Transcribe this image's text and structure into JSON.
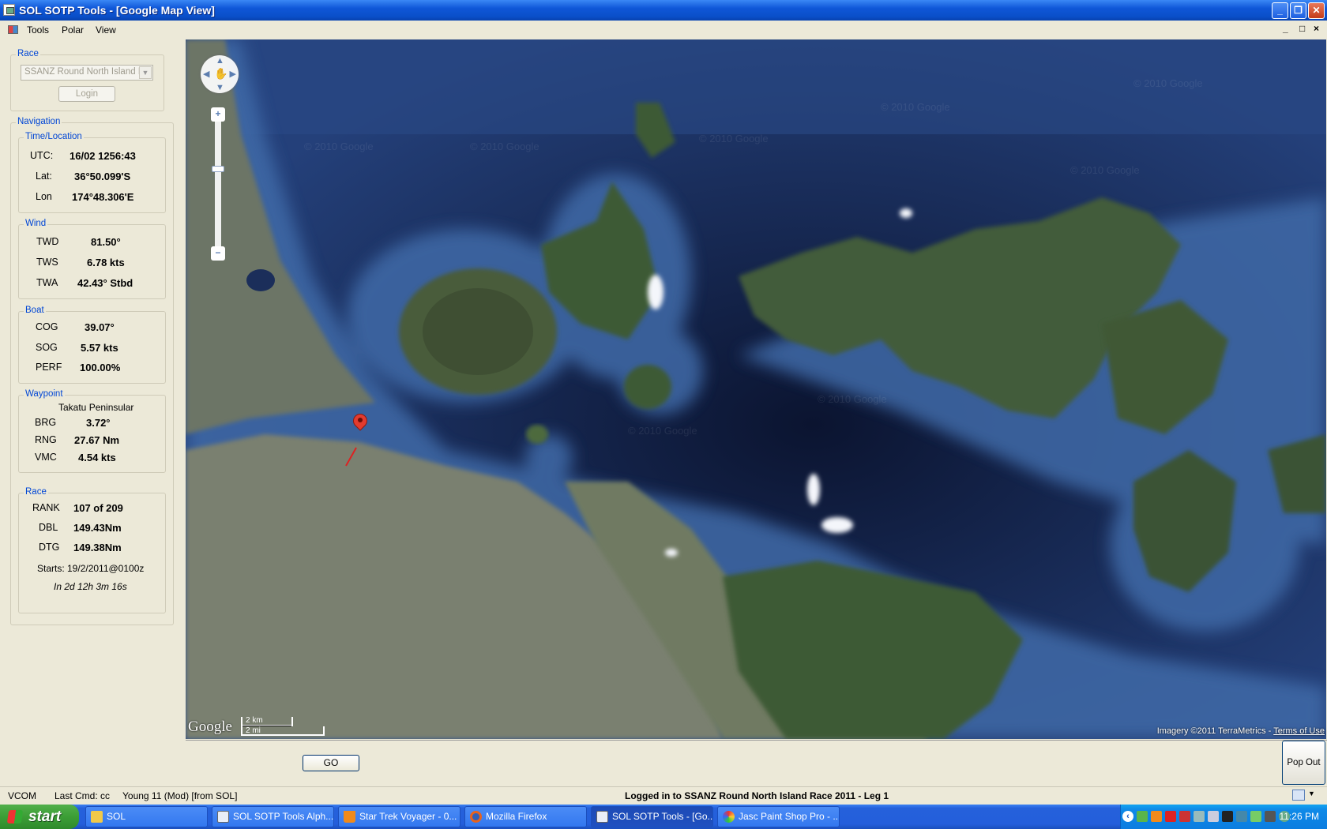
{
  "window": {
    "title": "SOL SOTP Tools - [Google Map View]"
  },
  "menu": {
    "items": [
      "Tools",
      "Polar",
      "View"
    ],
    "mdi": [
      "_",
      "□",
      "×"
    ]
  },
  "race_section": {
    "label": "Race",
    "selected_race": "SSANZ Round North Island R",
    "login_label": "Login"
  },
  "navigation": {
    "label": "Navigation",
    "time_location": {
      "label": "Time/Location",
      "utc_label": "UTC:",
      "utc": "16/02 1256:43",
      "lat_label": "Lat:",
      "lat": "36°50.099'S",
      "lon_label": "Lon",
      "lon": "174°48.306'E"
    },
    "wind": {
      "label": "Wind",
      "twd_label": "TWD",
      "twd": "81.50°",
      "tws_label": "TWS",
      "tws": "6.78 kts",
      "twa_label": "TWA",
      "twa": "42.43° Stbd"
    },
    "boat": {
      "label": "Boat",
      "cog_label": "COG",
      "cog": "39.07°",
      "sog_label": "SOG",
      "sog": "5.57 kts",
      "perf_label": "PERF",
      "perf": "100.00%"
    },
    "waypoint": {
      "label": "Waypoint",
      "name": "Takatu Peninsular",
      "brg_label": "BRG",
      "brg": "3.72°",
      "rng_label": "RNG",
      "rng": "27.67 Nm",
      "vmc_label": "VMC",
      "vmc": "4.54 kts"
    },
    "race": {
      "label": "Race",
      "rank_label": "RANK",
      "rank": "107 of 209",
      "dbl_label": "DBL",
      "dbl": "149.43Nm",
      "dtg_label": "DTG",
      "dtg": "149.38Nm",
      "starts": "Starts: 19/2/2011@0100z",
      "countdown": "In 2d 12h 3m 16s"
    }
  },
  "map": {
    "logo": "Google",
    "scale_km": "2 km",
    "scale_mi": "2 mi",
    "imagery": "Imagery ©2011 TerraMetrics - ",
    "terms": "Terms of Use",
    "watermark": "© 2010 Google"
  },
  "buttons": {
    "go": "GO",
    "pop_out": "Pop Out"
  },
  "statusbar": {
    "vcom": "VCOM",
    "last_cmd": "Last Cmd: cc",
    "version": "Young 11 (Mod) [from SOL]",
    "message": "Logged in to SSANZ Round North Island Race 2011 - Leg 1"
  },
  "taskbar": {
    "start_label": "start",
    "tasks": [
      "SOL",
      "SOL SOTP Tools Alph...",
      "Star Trek Voyager - 0...",
      "Mozilla Firefox",
      "SOL SOTP Tools - [Go...",
      "Jasc Paint Shop Pro - ..."
    ],
    "clock": "11:26 PM"
  }
}
